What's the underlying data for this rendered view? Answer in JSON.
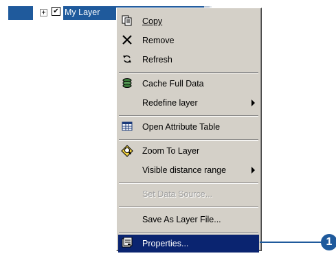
{
  "toc": {
    "layer_name": "My Layer",
    "expander_glyph": "+",
    "checked": true,
    "check_glyph": "✔"
  },
  "context_menu": {
    "items": [
      {
        "id": "copy",
        "label": "Copy",
        "icon": "copy-icon",
        "enabled": true
      },
      {
        "id": "remove",
        "label": "Remove",
        "icon": "remove-x-icon",
        "enabled": true
      },
      {
        "id": "refresh",
        "label": "Refresh",
        "icon": "refresh-icon",
        "enabled": true
      },
      {
        "id": "cache",
        "label": "Cache Full Data",
        "icon": "cache-stack-icon",
        "enabled": true
      },
      {
        "id": "redefine",
        "label": "Redefine layer",
        "submenu": true,
        "enabled": true
      },
      {
        "id": "attr",
        "label": "Open Attribute Table",
        "icon": "table-icon",
        "enabled": true
      },
      {
        "id": "zoom",
        "label": "Zoom To Layer",
        "icon": "zoom-layer-icon",
        "enabled": true
      },
      {
        "id": "visrange",
        "label": "Visible distance range",
        "submenu": true,
        "enabled": true
      },
      {
        "id": "datasource",
        "label": "Set Data Source...",
        "enabled": false
      },
      {
        "id": "saveas",
        "label": "Save As Layer File...",
        "enabled": true
      },
      {
        "id": "props",
        "label": "Properties...",
        "icon": "properties-icon",
        "enabled": true,
        "selected": true
      }
    ]
  },
  "callout": {
    "number": "1"
  },
  "colors": {
    "selection": "#0a2470",
    "menu_bg": "#d4d0c8",
    "accent": "#1f5a9c"
  }
}
